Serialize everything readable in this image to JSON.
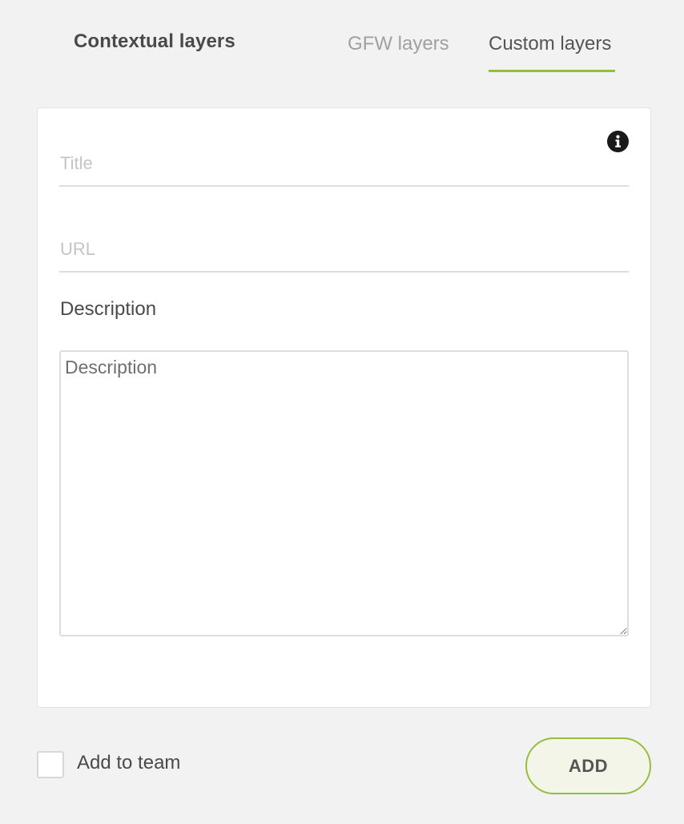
{
  "header": {
    "title": "Contextual layers",
    "tabs": [
      {
        "label": "GFW layers",
        "active": false
      },
      {
        "label": "Custom layers",
        "active": true
      }
    ],
    "accent_color": "#97bd3d"
  },
  "form": {
    "title_placeholder": "Title",
    "url_placeholder": "URL",
    "description_label": "Description",
    "description_placeholder": "Description",
    "info_icon": "info-icon"
  },
  "footer": {
    "add_to_team_label": "Add to team",
    "add_to_team_checked": false,
    "add_button_label": "ADD"
  }
}
